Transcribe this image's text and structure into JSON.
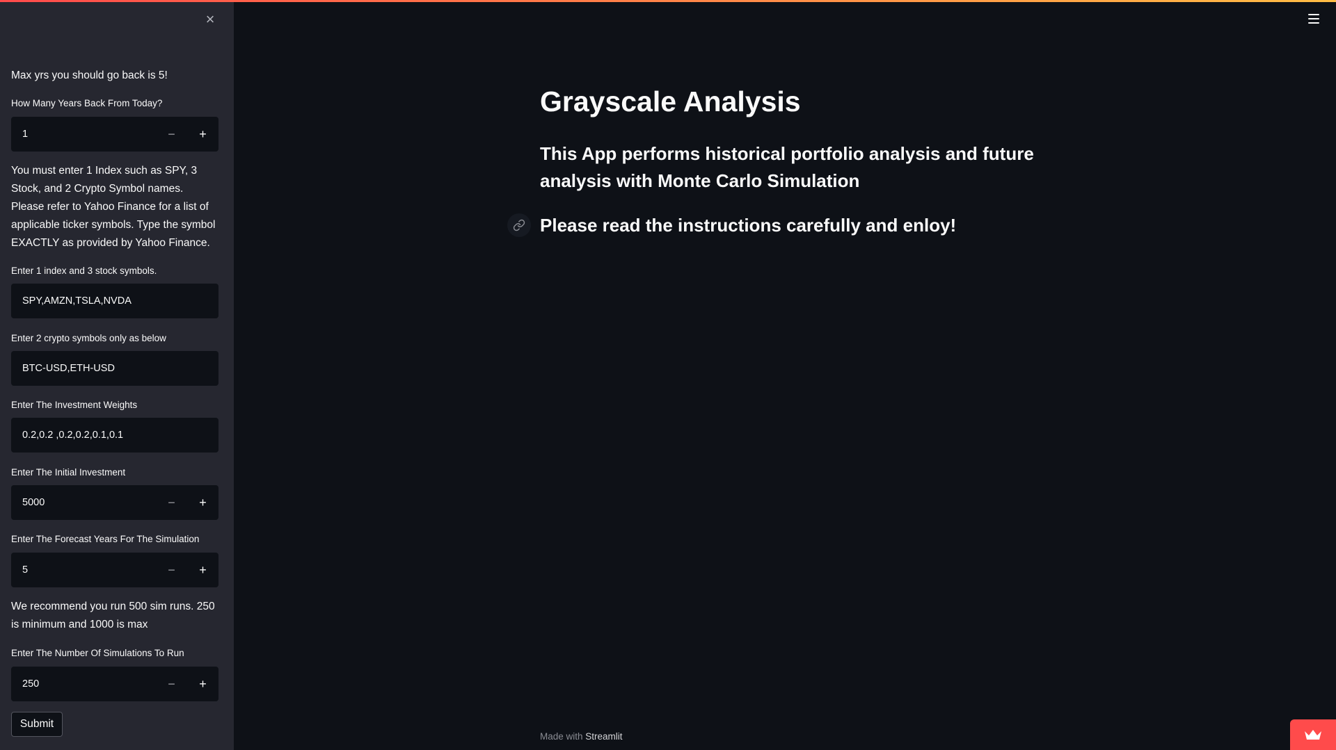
{
  "sidebar": {
    "close_icon": "×",
    "max_years_note": "Max yrs you should go back is 5!",
    "years_back": {
      "label": "How Many Years Back From Today?",
      "value": "1"
    },
    "instructions": "You must enter 1 Index such as SPY, 3 Stock, and 2 Crypto Symbol names. Please refer to Yahoo Finance for a list of applicable ticker symbols. Type the symbol EXACTLY as provided by Yahoo Finance.",
    "stock_symbols": {
      "label": "Enter 1 index and 3 stock symbols.",
      "value": "SPY,AMZN,TSLA,NVDA"
    },
    "crypto_symbols": {
      "label": "Enter 2 crypto symbols only as below",
      "value": "BTC-USD,ETH-USD"
    },
    "weights": {
      "label": "Enter The Investment Weights",
      "value": "0.2,0.2 ,0.2,0.2,0.1,0.1"
    },
    "initial_investment": {
      "label": "Enter The Initial Investment",
      "value": "5000"
    },
    "forecast_years": {
      "label": "Enter The Forecast Years For The Simulation",
      "value": "5"
    },
    "sim_note": "We recommend you run 500 sim runs. 250 is minimum and 1000 is max",
    "num_simulations": {
      "label": "Enter The Number Of Simulations To Run",
      "value": "250"
    },
    "stepper": {
      "minus": "−",
      "plus": "+"
    },
    "submit_label": "Submit"
  },
  "main": {
    "title": "Grayscale Analysis",
    "subtitle": "This App performs historical portfolio analysis and future analysis with Monte Carlo Simulation",
    "subtitle2": "Please read the instructions carefully and enloy!"
  },
  "footer": {
    "made_with": "Made with ",
    "brand": "Streamlit"
  },
  "icons": {
    "close": "close-icon",
    "menu": "hamburger-menu-icon",
    "anchor": "link-icon",
    "status": "crown-icon"
  },
  "colors": {
    "background": "#0e1117",
    "sidebar": "#262730",
    "accent": "#ff4b4b",
    "accent_gradient_end": "#ffbd45"
  }
}
